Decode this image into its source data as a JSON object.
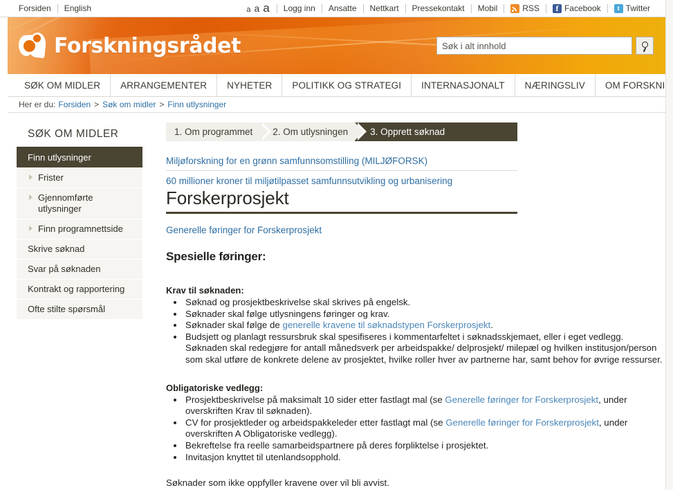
{
  "utility_bar": {
    "left_links": [
      "Forsiden",
      "English"
    ],
    "font_sizes": [
      "a",
      "a",
      "a"
    ],
    "right_links": [
      "Logg inn",
      "Ansatte",
      "Nettkart",
      "Pressekontakt",
      "Mobil"
    ],
    "social": [
      {
        "label": "RSS",
        "icon": "rss-icon"
      },
      {
        "label": "Facebook",
        "icon": "facebook-icon",
        "glyph": "f"
      },
      {
        "label": "Twitter",
        "icon": "twitter-icon",
        "glyph": "t"
      }
    ]
  },
  "banner": {
    "logo_text": "Forskningsrådet",
    "accent_orange": "#e8700c",
    "accent_amber": "#eeb00c"
  },
  "search": {
    "placeholder": "Søk i alt innhold",
    "value": "",
    "button_icon": "search-icon"
  },
  "main_nav": {
    "items": [
      "SØK OM MIDLER",
      "ARRANGEMENTER",
      "NYHETER",
      "POLITIKK OG STRATEGI",
      "INTERNASJONALT",
      "NÆRINGSLIV",
      "OM FORSKNINGSRÅDET"
    ]
  },
  "breadcrumb": {
    "label": "Her er du:",
    "items": [
      "Forsiden",
      "Søk om midler",
      "Finn utlysninger"
    ],
    "separator": ">"
  },
  "sidebar": {
    "title": "SØK OM MIDLER",
    "items": [
      {
        "label": "Finn utlysninger",
        "active": true,
        "sub": false
      },
      {
        "label": "Frister",
        "active": false,
        "sub": true
      },
      {
        "label": "Gjennomførte utlysninger",
        "active": false,
        "sub": true
      },
      {
        "label": "Finn programnettside",
        "active": false,
        "sub": true
      },
      {
        "label": "Skrive søknad",
        "active": false,
        "sub": false
      },
      {
        "label": "Svar på søknaden",
        "active": false,
        "sub": false
      },
      {
        "label": "Kontrakt og rapportering",
        "active": false,
        "sub": false
      },
      {
        "label": "Ofte stilte spørsmål",
        "active": false,
        "sub": false
      }
    ]
  },
  "steps": [
    {
      "label": "1. Om programmet",
      "current": false
    },
    {
      "label": "2. Om utlysningen",
      "current": false
    },
    {
      "label": "3. Opprett søknad",
      "current": true
    }
  ],
  "document": {
    "programme_link": "Miljøforskning for en grønn samfunnsomstilling (MILJØFORSK)",
    "call_link": "60 millioner kroner til miljøtilpasset samfunnsutvikling og urbanisering",
    "title": "Forskerprosjekt",
    "general_guidelines_link": "Generelle føringer for Forskerprosjekt",
    "special_heading": "Spesielle føringer:",
    "requirements_heading": "Krav til søknaden:",
    "requirements": [
      {
        "parts": [
          {
            "t": "Søknad og prosjektbeskrivelse skal skrives på engelsk.",
            "link": false
          }
        ]
      },
      {
        "parts": [
          {
            "t": "Søknader skal følge utlysningens føringer og krav.",
            "link": false
          }
        ]
      },
      {
        "parts": [
          {
            "t": "Søknader skal følge de ",
            "link": false
          },
          {
            "t": "generelle kravene til søknadstypen Forskerprosjekt",
            "link": true
          },
          {
            "t": ".",
            "link": false
          }
        ]
      },
      {
        "parts": [
          {
            "t": "Budsjett og planlagt ressursbruk skal spesifiseres i kommentarfeltet i søknadsskjemaet, eller i eget vedlegg. Søknaden skal redegjøre for antall månedsverk per arbeidspakke/ delprosjekt/ milepæl og hvilken institusjon/person som skal utføre de konkrete delene av prosjektet, hvilke roller hver av partnerne har, samt behov for øvrige ressurser.",
            "link": false
          }
        ]
      }
    ],
    "attachments_heading": "Obligatoriske vedlegg:",
    "attachments": [
      {
        "parts": [
          {
            "t": "Prosjektbeskrivelse på maksimalt 10 sider etter fastlagt mal (se ",
            "link": false
          },
          {
            "t": "Generelle føringer for Forskerprosjekt",
            "link": true
          },
          {
            "t": ", under overskriften Krav til søknaden).",
            "link": false
          }
        ]
      },
      {
        "parts": [
          {
            "t": "CV for prosjektleder og arbeidspakkeleder etter fastlagt mal (se ",
            "link": false
          },
          {
            "t": "Generelle føringer for Forskerprosjekt",
            "link": true
          },
          {
            "t": ", under overskriften A Obligatoriske vedlegg).",
            "link": false
          }
        ]
      },
      {
        "parts": [
          {
            "t": "Bekreftelse fra reelle samarbeidspartnere på deres forpliktelse i prosjektet.",
            "link": false
          }
        ]
      },
      {
        "parts": [
          {
            "t": "Invitasjon knyttet til utenlandsopphold.",
            "link": false
          }
        ]
      }
    ],
    "closing": "Søknader som ikke oppfyller kravene over vil bli avvist."
  }
}
